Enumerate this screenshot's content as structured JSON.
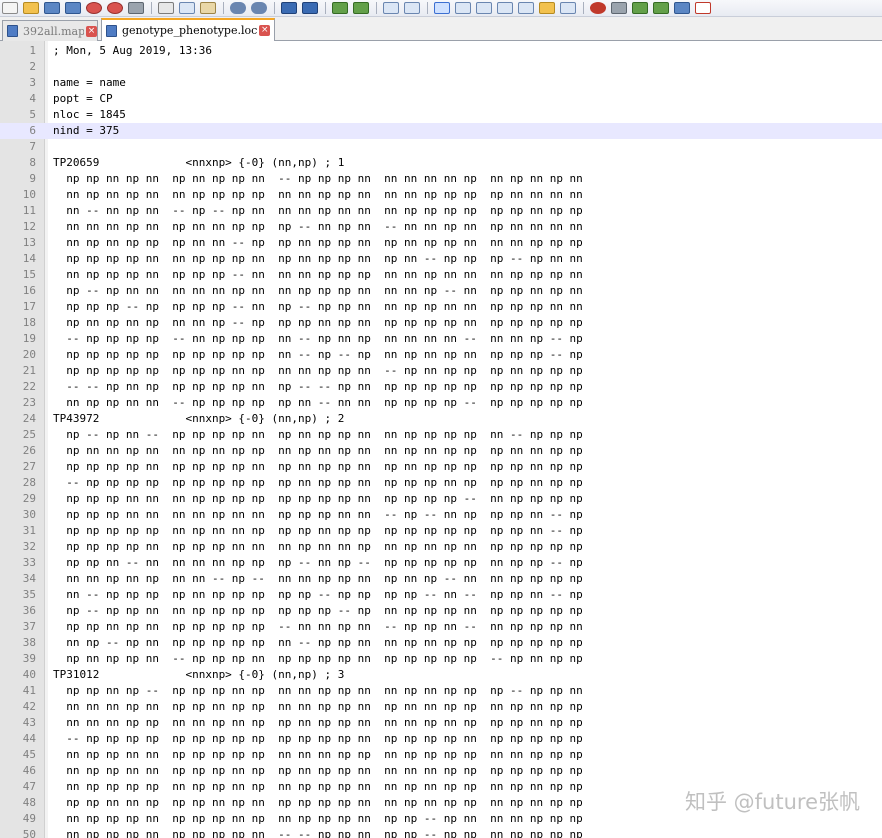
{
  "toolbar": {
    "buttons": [
      "new-file",
      "open-file",
      "save",
      "save-all",
      "close",
      "close-all",
      "print",
      "cut",
      "copy",
      "paste",
      "undo",
      "redo",
      "find",
      "replace",
      "zoom-in",
      "zoom-out",
      "sync-v",
      "sync-h",
      "wrap",
      "show-all",
      "indent-guide",
      "doc-map",
      "function-list",
      "folder-workspace",
      "monitor",
      "record-macro",
      "stop-record",
      "play-macro",
      "run-macro-multiple",
      "save-macro",
      "spellcheck"
    ]
  },
  "tabs": [
    {
      "label": "392all.map",
      "active": false
    },
    {
      "label": "genotype_phenotype.loc",
      "active": true
    }
  ],
  "editor": {
    "current_line": 6,
    "lines": [
      "; Mon, 5 Aug 2019, 13:36",
      "",
      "name = name",
      "popt = CP",
      "nloc = 1845",
      "nind = 375",
      "",
      "TP20659             <nnxnp> {-0} (nn,np) ; 1",
      "  np np nn np nn  np nn np np nn  -- np np np nn  nn nn nn nn np  nn np nn np nn",
      "  nn np nn np nn  nn np np np np  nn nn np np nn  nn nn np np np  np nn nn nn nn",
      "  nn -- nn np nn  -- np -- np nn  nn nn np nn nn  nn np np np np  np np nn np np",
      "  nn nn nn np nn  np nn nn np np  np -- nn np nn  -- nn nn np nn  np nn nn nn nn",
      "  nn np nn np np  np nn nn -- np  np nn np np nn  np nn np np nn  nn nn np np np",
      "  np np np np nn  nn np np np nn  np nn np np nn  np nn -- np np  np -- np nn nn",
      "  nn np np np nn  np np np -- nn  nn nn np np np  nn nn np nn nn  nn np np np nn",
      "  np -- np nn nn  nn nn nn np nn  nn np np np nn  nn nn np -- nn  np np nn np nn",
      "  np np np -- np  np np np -- nn  np -- np np nn  nn np np nn nn  np np np nn nn",
      "  np nn np nn np  nn nn np -- np  np np nn np nn  np np np np nn  np np np np np",
      "  -- np np np np  -- nn np np np  nn -- np nn np  nn nn nn nn --  nn nn np -- np",
      "  np np np np np  np np np np np  nn -- np -- np  nn np nn np nn  np np np -- np",
      "  np np np np np  np np np nn np  nn nn np np nn  -- np nn np np  np nn np np np",
      "  -- -- np nn np  np np np np nn  np -- -- np nn  np np np np np  np np np np np",
      "  nn np np nn nn  -- np np np np  np nn -- nn nn  np np np np --  np np np np np",
      "TP43972             <nnxnp> {-0} (nn,np) ; 2",
      "  np -- np nn --  np np np np nn  np nn np np nn  nn np np np np  nn -- np np np",
      "  np nn nn np nn  nn np nn np np  nn np nn np nn  nn np nn np np  np nn nn np np",
      "  np np np np nn  np np np np nn  np nn np np nn  np nn np np np  np np nn np np",
      "  -- np np np np  np np np np np  np nn np np nn  np np np nn np  np np nn np np",
      "  np np np nn nn  nn np np np np  np np np np nn  np np np np --  nn np np np np",
      "  np np np nn nn  nn nn np nn nn  np np np nn nn  -- np -- nn np  np np nn -- np",
      "  np np np np np  nn np nn nn np  np np nn np np  np np np np np  np np nn -- np",
      "  np np np np nn  np np np nn nn  nn np nn nn np  nn np nn np nn  np np np np np",
      "  np np nn -- nn  nn nn nn np np  np -- nn np --  np np np np np  nn np np -- np",
      "  nn nn np nn np  nn nn -- np --  nn nn np np nn  np nn np -- nn  nn np np np np",
      "  nn -- np np np  np nn np np np  np np -- np np  np np -- nn --  np np nn -- np",
      "  np -- np np nn  nn np np np np  np np np -- np  nn np np np nn  np np np np np",
      "  np np nn np nn  np np np np np  -- nn nn np nn  -- np np nn --  nn np np np nn",
      "  nn np -- np nn  np np np np np  nn -- np np nn  nn np nn np np  np np np np np",
      "  np nn np np nn  -- np np np nn  np np np np nn  np np np np np  -- np nn np np",
      "TP31012             <nnxnp> {-0} (nn,np) ; 3",
      "  np np nn np --  np np np nn np  nn nn np np nn  nn np nn np np  np -- np np nn",
      "  nn nn nn np nn  np np nn np np  nn nn np np nn  np nn nn np np  nn np nn np np",
      "  nn nn nn np np  nn nn np nn np  np nn np np nn  nn nn np nn np  np np nn np np",
      "  -- np np np np  np np np np np  np np np np nn  np np np np nn  np np np np np",
      "  nn np np nn nn  np np np np np  nn nn nn np np  nn np np np np  nn nn np np np",
      "  nn np np nn nn  np np np nn np  np nn np np nn  nn nn nn np np  np np np np np",
      "  nn np np np np  nn np np nn np  nn np np np nn  nn np nn np np  nn np nn np np",
      "  np np nn nn np  np np nn np nn  np np np np nn  nn np nn np np  nn np nn np np",
      "  nn np np np nn  np np np nn np  nn np np np nn  np np -- np nn  nn nn np np np",
      "  nn np np np nn  np np np np nn  -- -- np np nn  np np -- np np  nn np np np np"
    ]
  },
  "watermark": "知乎 @future张帆"
}
